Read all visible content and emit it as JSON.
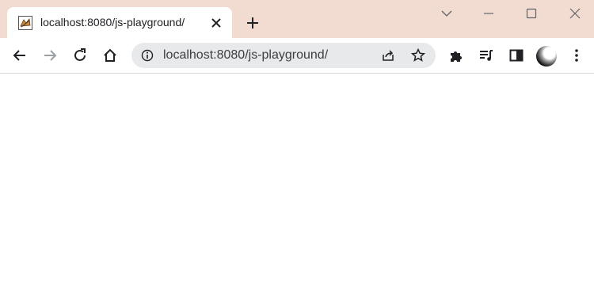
{
  "tab": {
    "title": "localhost:8080/js-playground/",
    "favicon": "tomcat-favicon-icon"
  },
  "omnibox": {
    "url": "localhost:8080/js-playground/"
  },
  "icons": {
    "back": "back-arrow-icon",
    "forward": "forward-arrow-icon",
    "reload": "reload-icon",
    "home": "home-icon",
    "info": "site-info-icon",
    "share": "share-icon",
    "bookmark": "bookmark-star-icon",
    "extensions": "puzzle-icon",
    "media": "media-queue-icon",
    "sidepanel": "side-panel-icon",
    "menu": "kebab-menu-icon"
  },
  "colors": {
    "tabstrip": "#f2dcd2",
    "omnibox": "#e8e9eb",
    "icon": "#202124"
  }
}
